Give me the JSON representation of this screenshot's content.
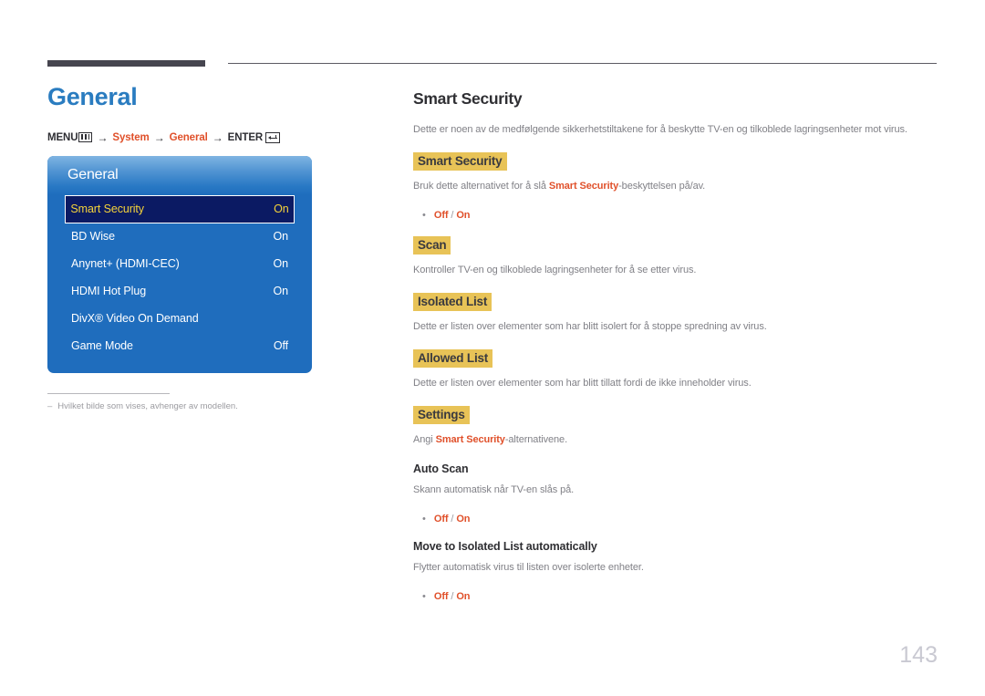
{
  "document": {
    "page_number": "143"
  },
  "left": {
    "page_title": "General",
    "menu_path": {
      "menu_label": "MENU",
      "menu_icon": "menu-bars-icon",
      "arrow": "→",
      "step1": "System",
      "step2": "General",
      "enter_label": "ENTER",
      "enter_icon": "enter-key-icon"
    },
    "osd": {
      "title": "General",
      "rows": [
        {
          "label": "Smart Security",
          "value": "On",
          "selected": true
        },
        {
          "label": "BD Wise",
          "value": "On",
          "selected": false
        },
        {
          "label": "Anynet+ (HDMI-CEC)",
          "value": "On",
          "selected": false
        },
        {
          "label": "HDMI Hot Plug",
          "value": "On",
          "selected": false
        },
        {
          "label": "DivX® Video On Demand",
          "value": "",
          "selected": false
        },
        {
          "label": "Game Mode",
          "value": "Off",
          "selected": false
        }
      ]
    },
    "footnote": {
      "dash": "–",
      "text": "Hvilket bilde som vises, avhenger av modellen."
    }
  },
  "right": {
    "section_title": "Smart Security",
    "intro": "Dette er noen av de medfølgende sikkerhetstiltakene for å beskytte TV-en og tilkoblede lagringsenheter mot virus.",
    "blocks": [
      {
        "heading": "Smart Security",
        "heading_style": "highlight",
        "body_before": "Bruk dette alternativet for å slå ",
        "body_accent": "Smart Security",
        "body_after": "-beskyttelsen på/av.",
        "bullet": {
          "off": "Off",
          "sep": " / ",
          "on": "On"
        }
      },
      {
        "heading": "Scan",
        "heading_style": "highlight",
        "body_before": "Kontroller TV-en og tilkoblede lagringsenheter for å se etter virus.",
        "body_accent": "",
        "body_after": "",
        "bullet": null
      },
      {
        "heading": "Isolated List",
        "heading_style": "highlight",
        "body_before": "Dette er listen over elementer som har blitt isolert for å stoppe spredning av virus.",
        "body_accent": "",
        "body_after": "",
        "bullet": null
      },
      {
        "heading": "Allowed List",
        "heading_style": "highlight",
        "body_before": "Dette er listen over elementer som har blitt tillatt fordi de ikke inneholder virus.",
        "body_accent": "",
        "body_after": "",
        "bullet": null
      },
      {
        "heading": "Settings",
        "heading_style": "highlight",
        "body_before": "Angi ",
        "body_accent": "Smart Security",
        "body_after": "-alternativene.",
        "bullet": null
      },
      {
        "heading": "Auto Scan",
        "heading_style": "plain",
        "body_before": "Skann automatisk når TV-en slås på.",
        "body_accent": "",
        "body_after": "",
        "bullet": {
          "off": "Off",
          "sep": " / ",
          "on": "On"
        }
      },
      {
        "heading": "Move to Isolated List automatically",
        "heading_style": "plain",
        "body_before": "Flytter automatisk virus til listen over isolerte enheter.",
        "body_accent": "",
        "body_after": "",
        "bullet": {
          "off": "Off",
          "sep": " / ",
          "on": "On"
        }
      }
    ]
  },
  "colors": {
    "title_blue": "#2a7cc0",
    "accent_orange": "#e0502a",
    "highlight_gold": "#e8c357",
    "osd_blue": "#1f6dbd",
    "osd_selected": "#0b1a63",
    "osd_selected_text": "#f5d33a",
    "body_gray": "#818187",
    "rule_dark": "#46454f",
    "page_number_gray": "#c9c9d2"
  }
}
